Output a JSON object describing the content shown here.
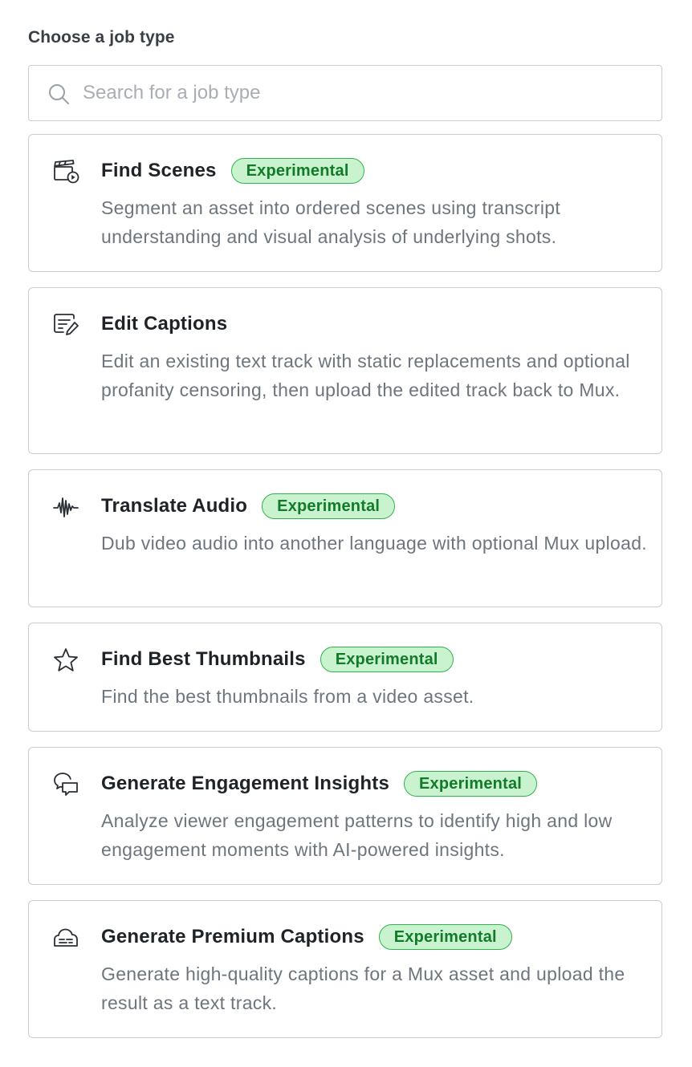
{
  "heading": "Choose a job type",
  "search": {
    "placeholder": "Search for a job type",
    "value": ""
  },
  "badge_color": "#c9f3cf",
  "badge_text_color": "#137a2a",
  "job_types": [
    {
      "icon": "clapperboard-play-icon",
      "title": "Find Scenes",
      "badge": "Experimental",
      "description": "Segment an asset into ordered scenes using transcript understanding and visual analysis of underlying shots."
    },
    {
      "icon": "edit-text-icon",
      "title": "Edit Captions",
      "badge": "",
      "description": "Edit an existing text track with static replacements and optional profanity censoring, then upload the edited track back to Mux."
    },
    {
      "icon": "audio-waveform-icon",
      "title": "Translate Audio",
      "badge": "Experimental",
      "description": "Dub video audio into another language with optional Mux upload."
    },
    {
      "icon": "star-icon",
      "title": "Find Best Thumbnails",
      "badge": "Experimental",
      "description": "Find the best thumbnails from a video asset."
    },
    {
      "icon": "chat-bubbles-icon",
      "title": "Generate Engagement Insights",
      "badge": "Experimental",
      "description": "Analyze viewer engagement patterns to identify high and low engagement moments with AI-powered insights."
    },
    {
      "icon": "captions-cloud-icon",
      "title": "Generate Premium Captions",
      "badge": "Experimental",
      "description": "Generate high-quality captions for a Mux asset and upload the result as a text track."
    }
  ]
}
